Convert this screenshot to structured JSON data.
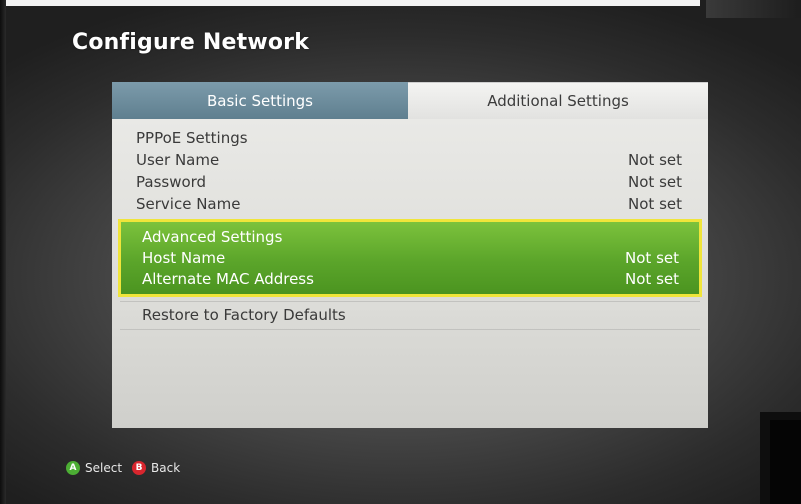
{
  "header": {
    "title": "Configure Network"
  },
  "tabs": [
    {
      "label": "Basic Settings",
      "selected": true
    },
    {
      "label": "Additional Settings",
      "selected": false
    }
  ],
  "pppoe": {
    "heading": "PPPoE Settings",
    "items": [
      {
        "label": "User Name",
        "value": "Not set"
      },
      {
        "label": "Password",
        "value": "Not set"
      },
      {
        "label": "Service Name",
        "value": "Not set"
      }
    ]
  },
  "advanced": {
    "heading": "Advanced Settings",
    "items": [
      {
        "label": "Host Name",
        "value": "Not set"
      },
      {
        "label": "Alternate MAC Address",
        "value": "Not set"
      }
    ]
  },
  "restore": {
    "label": "Restore to Factory Defaults"
  },
  "footer": {
    "a_glyph": "A",
    "a_label": "Select",
    "b_glyph": "B",
    "b_label": "Back"
  },
  "colors": {
    "selected_tab": "#6f8e9e",
    "highlight_green": "#5ba52a",
    "highlight_border": "#f0e53a",
    "button_a": "#4cae34",
    "button_b": "#d8262e"
  }
}
